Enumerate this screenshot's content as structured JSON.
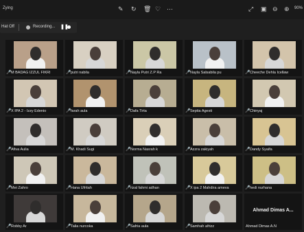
{
  "app": {
    "title": "Zying",
    "zoom": "90%"
  },
  "recording": {
    "status": "Hat Off",
    "label": "Recording..."
  },
  "participants": [
    {
      "name": "M BADAG IZZUL FIKRI",
      "video_color": "#b9a089"
    },
    {
      "name": "putri nabila",
      "video_color": "#d8d0c2"
    },
    {
      "name": "Nayla Putri Z.P Ra",
      "video_color": "#cbc7a6"
    },
    {
      "name": "Nayla Salsabila pu",
      "video_color": "#b9c1c8"
    },
    {
      "name": "Cheeche Dehla Icellaw",
      "video_color": "#d3c4ab"
    },
    {
      "name": "X IPA 2 - Izzy Edenio",
      "video_color": "#d2c6b3"
    },
    {
      "name": "farah aula",
      "video_color": "#b1936e"
    },
    {
      "name": "Dafa Tirta",
      "video_color": "#b7ad92"
    },
    {
      "name": "Septia Agesti",
      "video_color": "#c7b57f"
    },
    {
      "name": "Chinyaj",
      "video_color": "#d2c8b1"
    },
    {
      "name": "Afiva Aulia",
      "video_color": "#c4c0bb"
    },
    {
      "name": "M. Khadi Sugi",
      "video_color": "#d0cbc2"
    },
    {
      "name": "Norma Nasrah k",
      "video_color": "#dacfb8"
    },
    {
      "name": "Azzra zakiyah",
      "video_color": "#c9bea9"
    },
    {
      "name": "Dandy Syaifa",
      "video_color": "#d8c493"
    },
    {
      "name": "Mei Zahro",
      "video_color": "#cec7b7"
    },
    {
      "name": "Hana Ufritah",
      "video_color": "#cab89c"
    },
    {
      "name": "rizal fahmi adhan",
      "video_color": "#c0c2b9"
    },
    {
      "name": "X ipa 2 Mahdira ameva",
      "video_color": "#d8c99a"
    },
    {
      "name": "hedi nurhana",
      "video_color": "#cdbf86"
    },
    {
      "name": "Robby Ar",
      "video_color": "#3f3a39"
    },
    {
      "name": "Talia nurcoka",
      "video_color": "#c7b79c"
    },
    {
      "name": "Safria aula",
      "video_color": "#b5a68b"
    },
    {
      "name": "Samhah afrizz",
      "video_color": "#bcb9b1"
    },
    {
      "name": "Ahmad Dimas A.N",
      "video_color": "",
      "placeholder_text": "Ahmad Dimas A..."
    }
  ],
  "icons": {
    "edit": "edit-icon",
    "rotate": "rotate-icon",
    "trash": "trash-icon",
    "heart": "heart-icon",
    "more": "more-icon",
    "expand": "expand-icon",
    "fit": "fit-icon",
    "zoom_out": "zoom-out-icon",
    "zoom_in": "zoom-in-icon"
  }
}
